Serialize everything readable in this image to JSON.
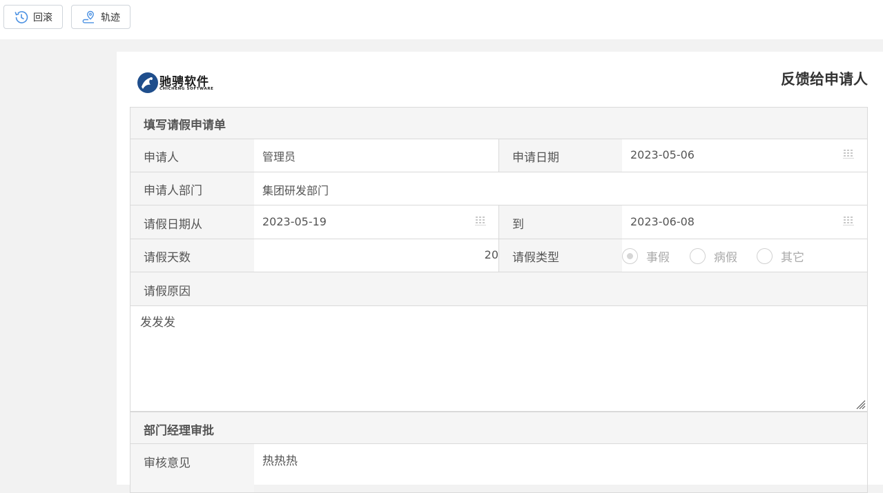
{
  "toolbar": {
    "rollback_label": "回滚",
    "track_label": "轨迹"
  },
  "header": {
    "logo_text": "驰骋软件",
    "logo_sub": "CHICHENG SOFTWARE",
    "form_title": "反馈给申请人"
  },
  "form": {
    "section1_title": "填写请假申请单",
    "applicant_label": "申请人",
    "applicant_value": "管理员",
    "apply_date_label": "申请日期",
    "apply_date_value": "2023-05-06",
    "dept_label": "申请人部门",
    "dept_value": "集团研发部门",
    "leave_from_label": "请假日期从",
    "leave_from_value": "2023-05-19",
    "to_label": "到",
    "to_value": "2023-06-08",
    "days_label": "请假天数",
    "days_value": "20",
    "type_label": "请假类型",
    "type_options": [
      "事假",
      "病假",
      "其它"
    ],
    "type_selected": "事假",
    "reason_label": "请假原因",
    "reason_value": "发发发",
    "section2_title": "部门经理审批",
    "review_label": "审核意见",
    "review_value": "热热热"
  },
  "colors": {
    "accent_icon": "#4a90e2",
    "label_bg": "#f5f5f5",
    "border": "#d9d9d9"
  }
}
